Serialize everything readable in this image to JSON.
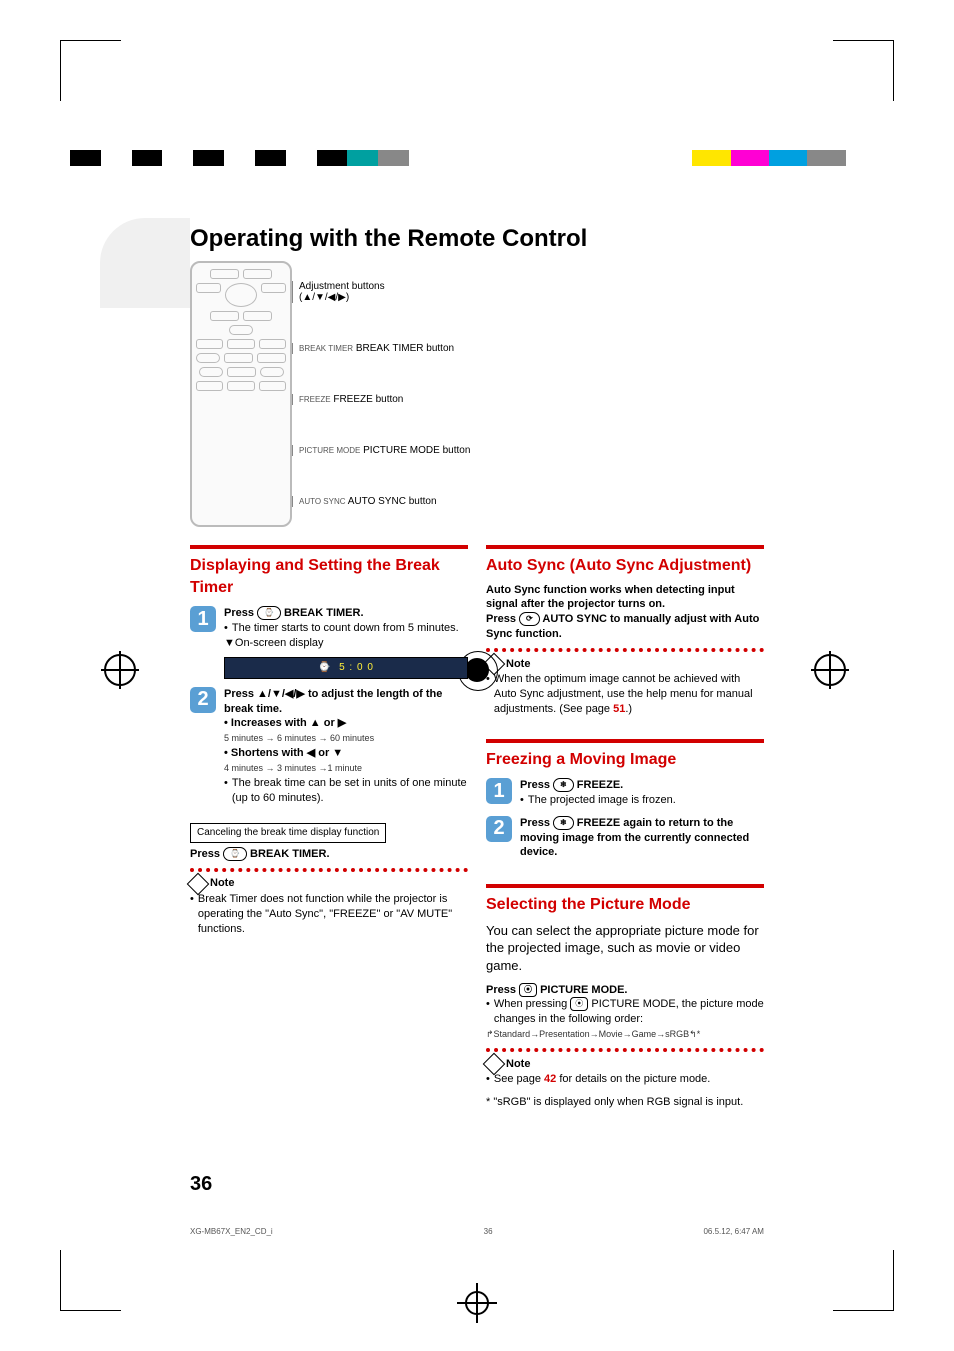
{
  "colorbar_left": [
    "#000",
    "#fff",
    "#000",
    "#fff",
    "#000",
    "#fff",
    "#000",
    "#fff",
    "#000",
    "#00a0a0",
    "#888",
    "#fff"
  ],
  "colorbar_right": [
    "#fff",
    "#ffe600",
    "#ff00d4",
    "#00a0e0",
    "#888",
    "#fff"
  ],
  "title": "Operating with the Remote Control",
  "remote": {
    "adj_label": "Adjustment buttons",
    "adj_symbol": "(▲/▼/◀/▶)",
    "callouts": [
      {
        "btn": "BREAK TIMER",
        "text": "BREAK TIMER button"
      },
      {
        "btn": "FREEZE",
        "text": "FREEZE button"
      },
      {
        "btn": "PICTURE MODE",
        "text": "PICTURE MODE button"
      },
      {
        "btn": "AUTO SYNC",
        "text": "AUTO SYNC button"
      }
    ]
  },
  "sec_break": {
    "heading": "Displaying and Setting the Break Timer",
    "step1_lead": "Press ",
    "step1_btn": "⌚",
    "step1_label": " BREAK TIMER.",
    "step1_bullet": "The timer starts to count down from 5 minutes.",
    "step1_osd": "▼On-screen display",
    "osd_icon": "⌚",
    "osd_time": "5 : 0 0",
    "step2_lead": "Press ▲/▼/◀/▶ to adjust the length of the break time.",
    "step2_inc": "Increases with ▲ or ▶",
    "step2_inc_sub": "5 minutes → 6 minutes → 60 minutes",
    "step2_dec": "Shortens with ◀ or ▼",
    "step2_dec_sub": "4 minutes → 3 minutes →1 minute",
    "step2_bullet2": "The break time can be set in units of one minute (up to 60 minutes).",
    "cancel_box": "Canceling the break time display function",
    "cancel_lead": "Press ",
    "cancel_btn": "⌚",
    "cancel_label": "  BREAK TIMER.",
    "note_h": "Note",
    "note_b": "Break Timer does not function while the projector is operating the \"Auto Sync\", \"FREEZE\" or \"AV MUTE\" functions."
  },
  "sec_autosync": {
    "heading": "Auto Sync (Auto Sync Adjustment)",
    "body1": "Auto Sync function works when detecting input signal after the projector turns on.",
    "body2_lead": "Press ",
    "body2_btn": "⟳",
    "body2_label": " AUTO SYNC to manually adjust with Auto Sync function.",
    "note_h": "Note",
    "note_b1": "When the optimum image cannot be achieved with Auto Sync adjustment, use the help menu for manual adjustments. (See page ",
    "note_pg": "51",
    "note_b2": ".)"
  },
  "sec_freeze": {
    "heading": "Freezing a Moving Image",
    "step1_lead": "Press ",
    "step1_btn": "❄",
    "step1_label": " FREEZE.",
    "step1_bullet": "The projected image is frozen.",
    "step2_lead": "Press ",
    "step2_btn": "❄",
    "step2_label": " FREEZE again to return to the moving image from the currently connected device."
  },
  "sec_picture": {
    "heading": "Selecting the Picture Mode",
    "intro": "You can select the appropriate picture mode for the projected image, such as movie or video game.",
    "press_lead": "Press ",
    "press_btn": "⦿",
    "press_label": " PICTURE MODE.",
    "bullet1": "When pressing ",
    "bullet1_btn": "⦿",
    "bullet1_tail": " PICTURE MODE, the picture mode changes in the following order:",
    "cycle": "Standard→Presentation→Movie→Game→sRGB",
    "cycle_star": "*",
    "note_h": "Note",
    "note_b1": "See page ",
    "note_pg": "42",
    "note_b2": " for details on the picture mode.",
    "foot": "* \"sRGB\" is displayed only when RGB signal is input."
  },
  "pgnum": "36",
  "footer": {
    "file": "XG-MB67X_EN2_CD_i",
    "page": "36",
    "ts": "06.5.12, 6:47 AM"
  }
}
